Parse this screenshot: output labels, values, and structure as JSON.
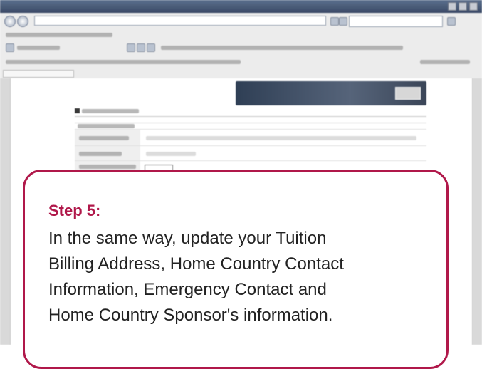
{
  "browser": {
    "title": "",
    "address": "",
    "menu_items": [
      "",
      "",
      "",
      "",
      "",
      ""
    ],
    "tab_label": ""
  },
  "page": {
    "logo": "",
    "banner_text": ""
  },
  "callout": {
    "step_label": "Step 5:",
    "body_lines": [
      "In the same way, update your Tuition",
      "Billing Address, Home Country Contact",
      "Information, Emergency Contact and",
      "Home Country Sponsor's information."
    ]
  },
  "colors": {
    "accent": "#b0184a",
    "text": "#222222"
  }
}
